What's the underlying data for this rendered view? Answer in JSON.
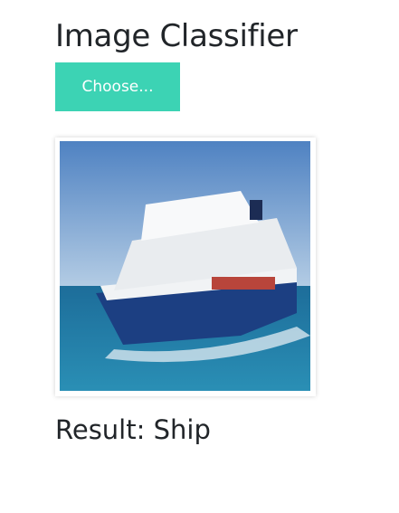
{
  "title": "Image Classifier",
  "choose_button": "Choose...",
  "result": {
    "label": "Result:",
    "value": "Ship"
  },
  "colors": {
    "accent": "#3cd3b4"
  }
}
